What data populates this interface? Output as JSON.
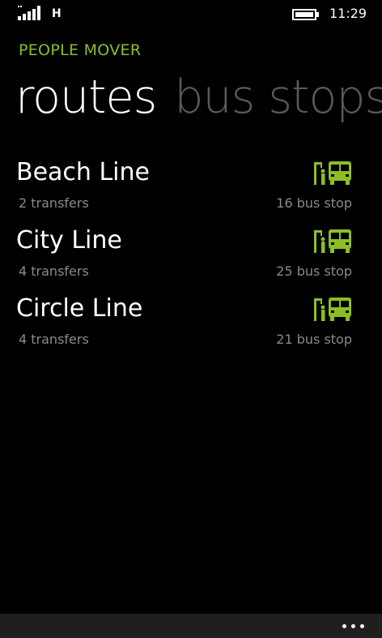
{
  "status_bar": {
    "signal_icon": "signal-strength-icon",
    "network_type": "H",
    "battery_icon": "battery-icon",
    "time": "11:29"
  },
  "header": {
    "app_title": "PEOPLE MOVER",
    "pivots": [
      {
        "label": "routes",
        "active": true
      },
      {
        "label": "bus stops",
        "active": false
      }
    ]
  },
  "routes": [
    {
      "name": "Beach Line",
      "transfers": "2 transfers",
      "stops": "16 bus stop",
      "icon": "bus-stop-icon"
    },
    {
      "name": "City Line",
      "transfers": "4 transfers",
      "stops": "25 bus stop",
      "icon": "bus-stop-icon"
    },
    {
      "name": "Circle Line",
      "transfers": "4 transfers",
      "stops": "21 bus stop",
      "icon": "bus-stop-icon"
    }
  ],
  "app_bar": {
    "more_icon": "more-options-icon"
  },
  "colors": {
    "accent": "#8cbf26",
    "background": "#000000",
    "secondary_text": "#8a8a8a",
    "inactive_pivot": "#5a5a5a",
    "app_bar": "#1f1f1f"
  }
}
